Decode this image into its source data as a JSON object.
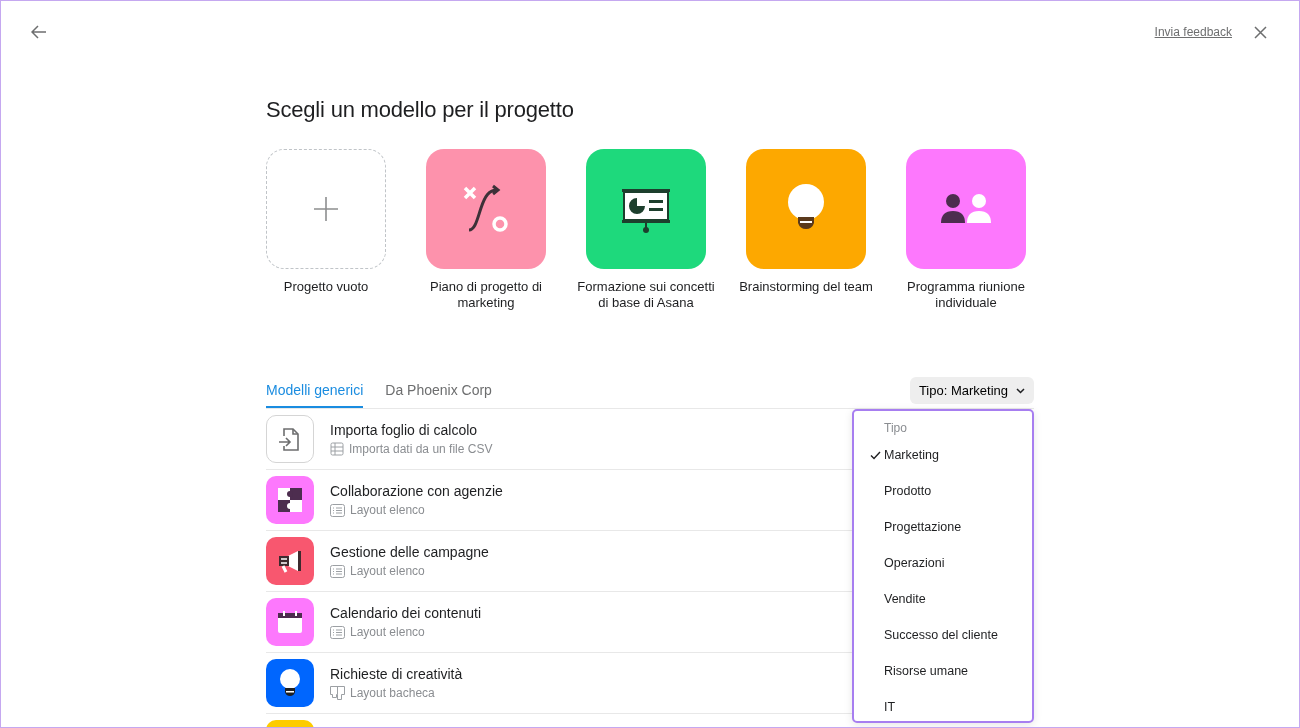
{
  "header": {
    "feedback_link": "Invia feedback"
  },
  "title": "Scegli un modello per il progetto",
  "featured": [
    {
      "kind": "blank",
      "label": "Progetto vuoto"
    },
    {
      "kind": "plan",
      "color": "#fd92ac",
      "label": "Piano di progetto di marketing"
    },
    {
      "kind": "presentation",
      "color": "#1ed97c",
      "label": "Formazione sui concetti di base di Asana"
    },
    {
      "kind": "bulb",
      "color": "#fda800",
      "label": "Brainstorming del team"
    },
    {
      "kind": "people",
      "color": "#fd78fd",
      "label": "Programma riunione individuale"
    }
  ],
  "tabs": [
    {
      "label": "Modelli generici",
      "selected": true
    },
    {
      "label": "Da Phoenix Corp",
      "selected": false
    }
  ],
  "filter": {
    "label": "Tipo: Marketing"
  },
  "templates": [
    {
      "kind": "import",
      "title": "Importa foglio di calcolo",
      "subtitle": {
        "kind": "table",
        "text": "Importa dati da un file CSV"
      }
    },
    {
      "kind": "puzzle",
      "color": "#fd78fd",
      "title": "Collaborazione con agenzie",
      "subtitle": {
        "kind": "list",
        "text": "Layout elenco"
      }
    },
    {
      "kind": "megaphone",
      "color": "#f8576f",
      "title": "Gestione delle campagne",
      "subtitle": {
        "kind": "list",
        "text": "Layout elenco"
      }
    },
    {
      "kind": "calendar",
      "color": "#fd78fd",
      "title": "Calendario dei contenuti",
      "subtitle": {
        "kind": "list",
        "text": "Layout elenco"
      }
    },
    {
      "kind": "bulb",
      "color": "#0066fe",
      "title": "Richieste di creatività",
      "subtitle": {
        "kind": "board",
        "text": "Layout bacheca"
      }
    },
    {
      "kind": "partial",
      "color": "#fdcc00"
    }
  ],
  "dropdown": {
    "heading": "Tipo",
    "options": [
      {
        "label": "Marketing",
        "selected": true
      },
      {
        "label": "Prodotto",
        "selected": false
      },
      {
        "label": "Progettazione",
        "selected": false
      },
      {
        "label": "Operazioni",
        "selected": false
      },
      {
        "label": "Vendite",
        "selected": false
      },
      {
        "label": "Successo del cliente",
        "selected": false
      },
      {
        "label": "Risorse umane",
        "selected": false
      },
      {
        "label": "IT",
        "selected": false
      }
    ]
  }
}
